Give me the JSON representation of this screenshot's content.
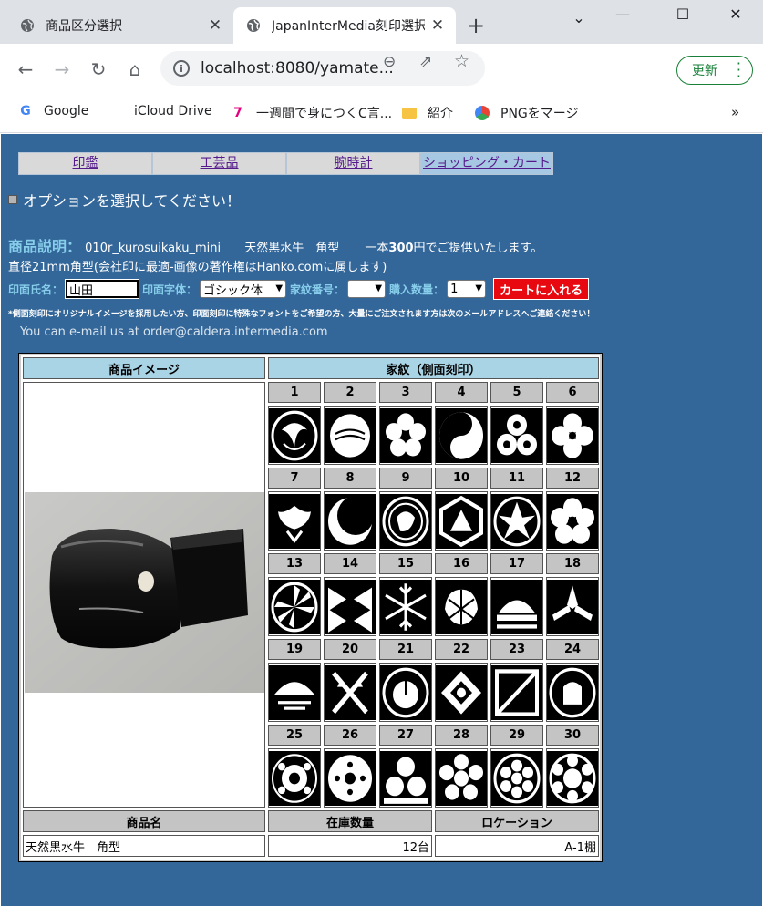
{
  "browser": {
    "tabs": [
      {
        "title": "商品区分選択",
        "active": false
      },
      {
        "title": "JapanInterMedia刻印選択",
        "active": true
      }
    ],
    "url": "localhost:8080/yamate...",
    "update_label": "更新",
    "bookmarks": [
      {
        "label": "Google",
        "icon": "google-icon"
      },
      {
        "label": "iCloud Drive",
        "icon": "apple-icon"
      },
      {
        "label": "一週間で身につくC言...",
        "icon": "seven-icon"
      },
      {
        "label": "紹介",
        "icon": "folder-icon"
      },
      {
        "label": "PNGをマージ",
        "icon": "png-icon"
      }
    ]
  },
  "menu": [
    {
      "label": "印鑑"
    },
    {
      "label": "工芸品"
    },
    {
      "label": "腕時計"
    },
    {
      "label": "ショッピング・カート"
    }
  ],
  "option_prompt": "オプションを選択してください！",
  "description": {
    "label": "商品説明：",
    "code": "010r_kurosuikaku_mini",
    "name": "天然黒水牛　角型",
    "price_prefix": "一本",
    "price": "300",
    "price_suffix": "円でご提供いたします。",
    "sub": "直径21mm角型(会社印に最適-画像の著作権はHanko.comに属します)"
  },
  "form": {
    "name_label": "印面氏名：",
    "name_value": "山田",
    "font_label": "印面字体：",
    "font_value": "ゴシック体",
    "crest_label": "家紋番号：",
    "crest_value": "",
    "qty_label": "購入数量：",
    "qty_value": "1",
    "cart_button": "カートに入れる"
  },
  "note": "*側面刻印にオリジナルイメージを採用したい方、印面刻印に特殊なフォントをご希望の方、大量にご注文されます方は次のメールアドレスへご連絡ください！",
  "mail": "You can e-mail us at order@caldera.intermedia.com",
  "table": {
    "image_header": "商品イメージ",
    "crest_header": "家紋（側面刻印）",
    "crest_numbers": [
      "1",
      "2",
      "3",
      "4",
      "5",
      "6",
      "7",
      "8",
      "9",
      "10",
      "11",
      "12",
      "13",
      "14",
      "15",
      "16",
      "17",
      "18",
      "19",
      "20",
      "21",
      "22",
      "23",
      "24",
      "25",
      "26",
      "27",
      "28",
      "29",
      "30"
    ],
    "footer_headers": [
      "商品名",
      "在庫数量",
      "ロケーション"
    ],
    "footer_values": [
      "天然黒水牛　角型",
      "12台",
      "A-1棚"
    ]
  },
  "colors": {
    "page_bg": "#336699",
    "header_bg": "#a9d4e6",
    "cart_button_bg": "#e8080f",
    "label_color": "#87ceeb"
  }
}
